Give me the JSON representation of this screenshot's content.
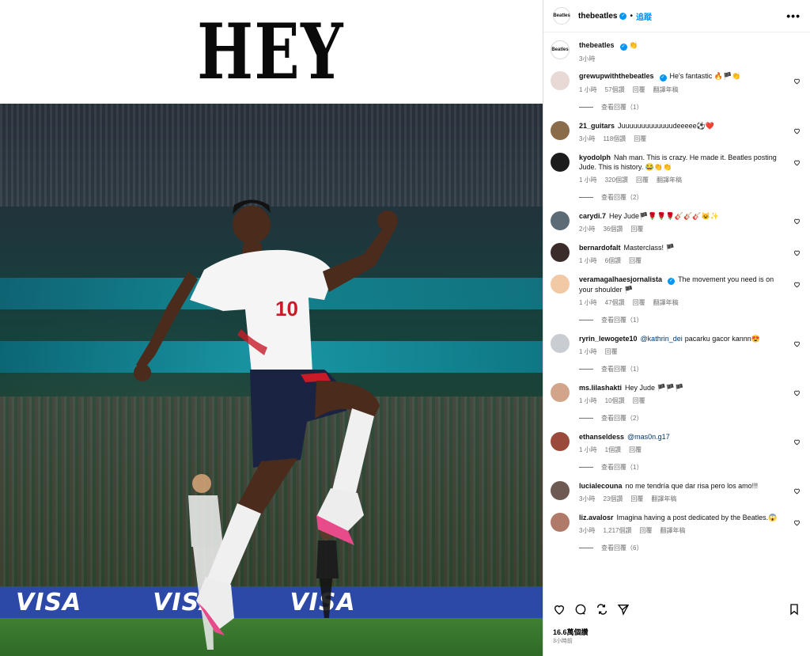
{
  "post_image": {
    "headline": "HEY",
    "shirt_number": "10",
    "sponsor": "VISA"
  },
  "header": {
    "username": "thebeatles",
    "avatar_text": "Beatles",
    "dot": "•",
    "follow_label": "追蹤",
    "more": "•••"
  },
  "caption": {
    "username": "thebeatles",
    "text": "👏",
    "time": "3小時"
  },
  "comments": [
    {
      "username": "grewupwiththebeatles",
      "verified": true,
      "text": "He's fantastic 🔥🏴👏",
      "time": "1 小時",
      "likes": "57個讚",
      "reply": "回覆",
      "translate": "翻譯年稿",
      "replies": "查看回覆（1）",
      "avatar_color": "#e8d9d5"
    },
    {
      "username": "21_guitars",
      "verified": false,
      "text": "Juuuuuuuuuuuuudeeeee⚽❤️",
      "time": "3小時",
      "likes": "118個讚",
      "reply": "回覆",
      "translate": "",
      "replies": "",
      "avatar_color": "#8a6b4a"
    },
    {
      "username": "kyodolph",
      "verified": false,
      "text": "Nah man. This is crazy. He made it. Beatles posting Jude. This is history. 😂👏👏",
      "time": "1 小時",
      "likes": "320個讚",
      "reply": "回覆",
      "translate": "翻譯年稿",
      "replies": "查看回覆（2）",
      "avatar_color": "#1c1c1c"
    },
    {
      "username": "carydi.7",
      "verified": false,
      "text": "Hey Jude🏴🌹🌹🌹🎸🎸🎸😺✨",
      "time": "2小時",
      "likes": "36個讚",
      "reply": "回覆",
      "translate": "",
      "replies": "",
      "avatar_color": "#5c6b75"
    },
    {
      "username": "bernardofalt",
      "verified": false,
      "text": "Masterclass! 🏴",
      "time": "1 小時",
      "likes": "6個讚",
      "reply": "回覆",
      "translate": "",
      "replies": "",
      "avatar_color": "#3a2c2a"
    },
    {
      "username": "veramagalhaesjornalista",
      "verified": true,
      "text": "The movement you need is on your shoulder 🏴",
      "time": "1 小時",
      "likes": "47個讚",
      "reply": "回覆",
      "translate": "翻譯年稿",
      "replies": "查看回覆（1）",
      "avatar_color": "#f1c9a5"
    },
    {
      "username": "ryrin_lewogete10",
      "verified": false,
      "text": "pacarku gacor kannn😍",
      "mention": "@kathrin_dei",
      "time": "1 小時",
      "likes": "",
      "reply": "回覆",
      "translate": "",
      "replies": "查看回覆（1）",
      "avatar_color": "#c9ccd1"
    },
    {
      "username": "ms.lilashakti",
      "verified": false,
      "text": "Hey Jude 🏴🏴🏴",
      "time": "1 小時",
      "likes": "10個讚",
      "reply": "回覆",
      "translate": "",
      "replies": "查看回覆（2）",
      "avatar_color": "#d2a58a"
    },
    {
      "username": "ethanseldess",
      "verified": false,
      "text": "",
      "mention": "@mas0n.g17",
      "time": "1 小時",
      "likes": "1個讚",
      "reply": "回覆",
      "translate": "",
      "replies": "查看回覆（1）",
      "avatar_color": "#9a4a3a"
    },
    {
      "username": "lucialecouna",
      "verified": false,
      "text": "no me tendría que dar risa pero los amo!!!",
      "time": "3小時",
      "likes": "23個讚",
      "reply": "回覆",
      "translate": "翻譯年稿",
      "replies": "",
      "avatar_color": "#6e5a52"
    },
    {
      "username": "liz.avalosr",
      "verified": false,
      "text": "Imagina having a post dedicated by the Beatles.😱",
      "time": "3小時",
      "likes": "1,217個讚",
      "reply": "回覆",
      "translate": "翻譯年稿",
      "replies": "查看回覆（6）",
      "avatar_color": "#b07a68"
    }
  ],
  "footer": {
    "likes": "16.6萬個讚",
    "time": "3小時前"
  }
}
